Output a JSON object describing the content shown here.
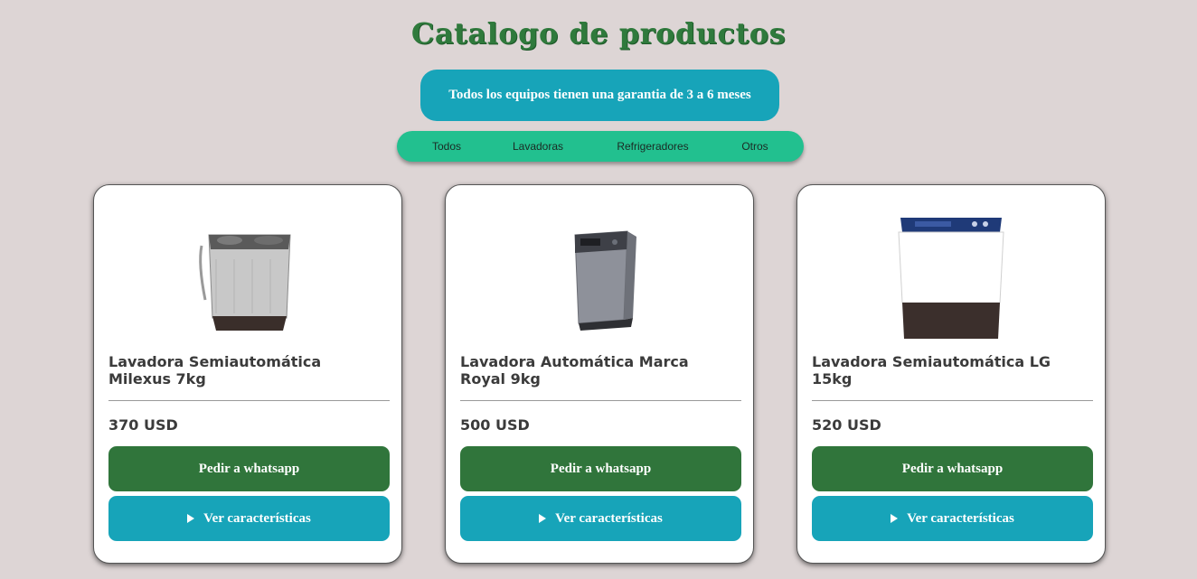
{
  "header": {
    "title": "Catalogo de productos",
    "banner": "Todos los equipos tienen una garantia de 3 a 6 meses"
  },
  "nav": {
    "items": [
      "Todos",
      "Lavadoras",
      "Refrigeradores",
      "Otros"
    ]
  },
  "products": [
    {
      "name": "Lavadora Semiautomática Milexus 7kg",
      "price": "370 USD",
      "image": "twin-tub-washer-gray",
      "order_label": "Pedir a whatsapp",
      "features_label": "Ver características"
    },
    {
      "name": "Lavadora Automática Marca Royal 9kg",
      "price": "500 USD",
      "image": "top-load-washer-gray",
      "order_label": "Pedir a whatsapp",
      "features_label": "Ver características"
    },
    {
      "name": "Lavadora Semiautomática LG 15kg",
      "price": "520 USD",
      "image": "twin-tub-washer-white-blue",
      "order_label": "Pedir a whatsapp",
      "features_label": "Ver características"
    }
  ],
  "colors": {
    "background": "#ddd5d5",
    "title": "#2f7a3c",
    "banner": "#17a4b9",
    "nav": "#22c08f",
    "whatsapp_button": "#30753b",
    "features_button": "#17a4b9"
  }
}
